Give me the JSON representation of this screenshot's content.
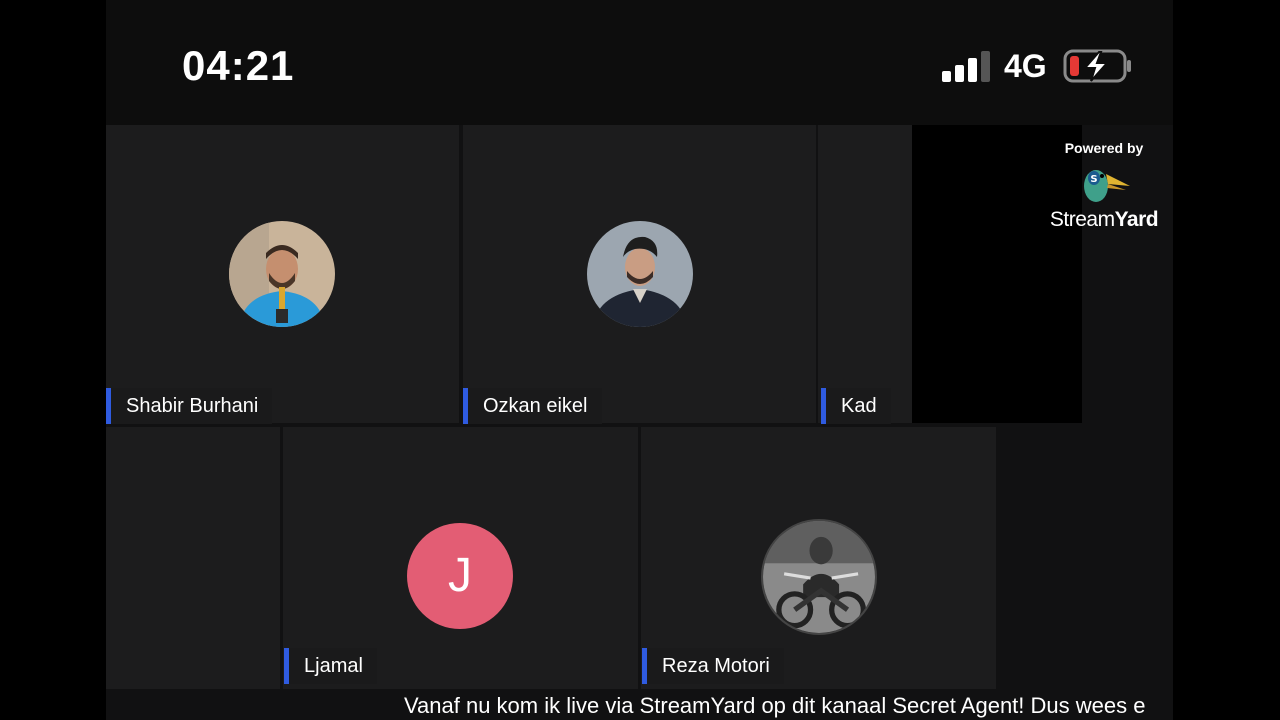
{
  "status_bar": {
    "time": "04:21",
    "network": "4G",
    "signal_icon": "cellular-signal-icon",
    "battery_icon": "battery-charging-icon"
  },
  "participants": [
    {
      "name": "Shabir Burhani",
      "avatar": "photo"
    },
    {
      "name": "Ozkan eikel",
      "avatar": "photo"
    },
    {
      "name": "Kad",
      "avatar": "none"
    },
    {
      "name": "Ljamal",
      "avatar": "letter",
      "initial": "J",
      "color": "#e35d74"
    },
    {
      "name": "Reza Motori",
      "avatar": "photo"
    }
  ],
  "branding": {
    "powered_by": "Powered by",
    "brand_regular": "Stream",
    "brand_bold": "Yard",
    "logo_icon": "streamyard-duck-logo-icon"
  },
  "ticker": {
    "text": "Vanaf nu kom ik live via StreamYard op dit kanaal Secret Agent! Dus wees e"
  },
  "colors": {
    "nametag_accent": "#2f5be0",
    "tile_background": "#1c1c1d",
    "battery_low": "#e53935"
  }
}
